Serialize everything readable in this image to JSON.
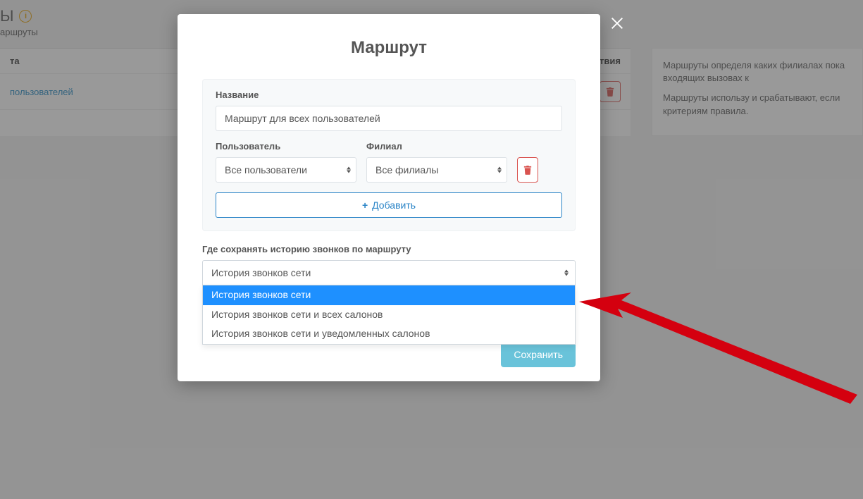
{
  "background": {
    "page_title_fragment": "Ы",
    "subtitle_fragment": "аршруты",
    "table": {
      "col_route_fragment": "та",
      "col_actions": "Действия",
      "row_route_link": "пользователей"
    },
    "sidebar": {
      "p1": "Маршруты определя\nкаких филиалах пока\nвходящих вызовах к",
      "p2": "Маршруты использу\nи срабатывают, если\nкритериям правила."
    }
  },
  "modal": {
    "title": "Маршрут",
    "name_label": "Название",
    "name_value": "Маршрут для всех пользователей",
    "user_label": "Пользователь",
    "branch_label": "Филиал",
    "user_value": "Все пользователи",
    "branch_value": "Все филиалы",
    "add_button": "Добавить",
    "history_label": "Где сохранять историю звонков по маршруту",
    "history_selected": "История звонков сети",
    "history_options": [
      "История звонков сети",
      "История звонков сети и всех салонов",
      "История звонков сети и уведомленных салонов"
    ],
    "save_button": "Сохранить"
  },
  "icons": {
    "close": "close-icon",
    "trash": "trash-icon",
    "pencil": "pencil-icon",
    "plus": "plus-icon",
    "info": "info-icon"
  }
}
